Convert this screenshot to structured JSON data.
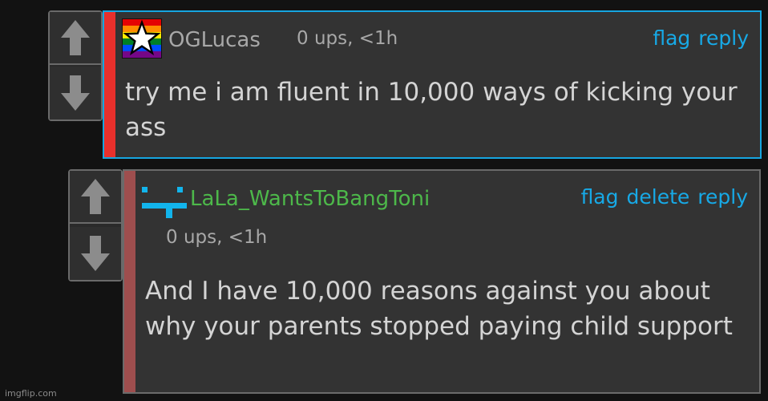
{
  "comments": [
    {
      "username": "OGLucas",
      "meta": "0 ups, <1h",
      "actions": [
        "flag",
        "reply"
      ],
      "body": "try me i am fluent in 10,000 ways of kicking your ass",
      "avatar_icon": "rainbow-star-icon",
      "stripe_color": "#e8302c",
      "border_color": "#16a5e0"
    },
    {
      "username": "LaLa_WantsToBangToni",
      "meta": "0 ups, <1h",
      "actions": [
        "flag",
        "delete",
        "reply"
      ],
      "body": "And I have 10,000 reasons against you about why your parents stopped paying child support",
      "avatar_icon": "pixel-face-icon",
      "username_color": "#4db84a",
      "stripe_color": "#9e4e4e"
    }
  ],
  "vote_icons": {
    "up": "arrow-up-icon",
    "down": "arrow-down-icon"
  },
  "link_color": "#17a9e6",
  "watermark": "imgflip.com"
}
